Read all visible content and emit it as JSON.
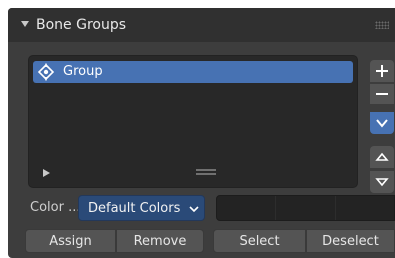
{
  "panel": {
    "title": "Bone Groups",
    "collapse_icon": "triangle-down-icon",
    "grip_icon": "drag-grip-icon"
  },
  "list": {
    "items": [
      {
        "label": "Group",
        "icon": "bone-group-icon",
        "selected": true
      }
    ],
    "filter_icon": "triangle-right-icon",
    "resize_icon": "resize-grip-icon"
  },
  "side_buttons": {
    "add": "plus-icon",
    "remove": "minus-icon",
    "specials": "chevron-down-icon",
    "move_up": "triangle-up-icon",
    "move_down": "triangle-down-icon"
  },
  "color": {
    "label": "Color ...",
    "value": "Default Colors"
  },
  "buttons": {
    "assign": "Assign",
    "remove": "Remove",
    "select": "Select",
    "deselect": "Deselect"
  },
  "colors": {
    "accent": "#4772b3",
    "panel_bg": "#3d3d3d",
    "header_bg": "#303030",
    "list_bg": "#282828",
    "button_bg": "#545454",
    "dropdown_bg": "#2a4a78"
  }
}
